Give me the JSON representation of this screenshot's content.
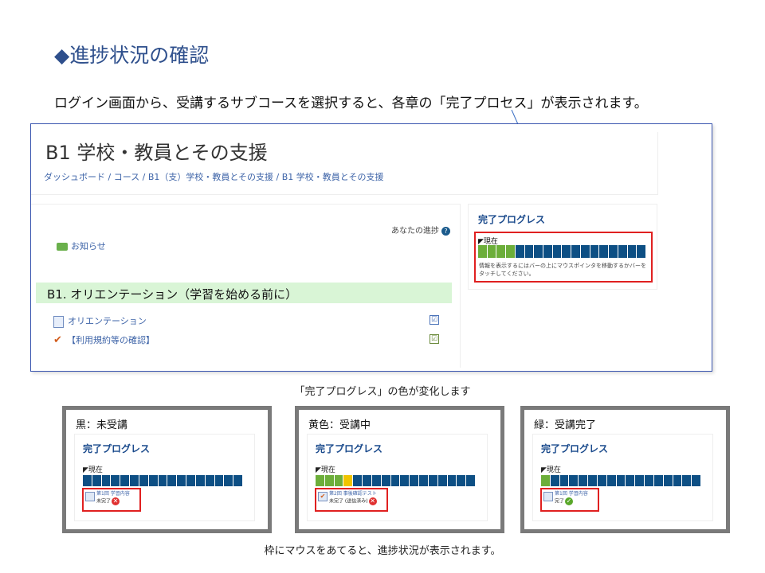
{
  "slide": {
    "title": "◆進捗状況の確認",
    "intro": "ログイン画面から、受講するサブコースを選択すると、各章の「完了プロセス」が表示されます。",
    "caption_middle": "「完了プログレス」の色が変化します",
    "caption_bottom": "枠にマウスをあてると、進捗状況が表示されます。"
  },
  "colors": {
    "dark": "#0d4f84",
    "green": "#6cae3a",
    "yellow": "#f0c400",
    "red": "#e02020"
  },
  "course": {
    "title": "B1 学校・教員とその支援",
    "breadcrumb": "ダッシュボード / コース / B1（支）学校・教員とその支援 / B1 学校・教員とその支援",
    "progress_label": "あなたの進捗",
    "help": "?",
    "news": "お知らせ",
    "section_title": "B1. オリエンテーション（学習を始める前に）",
    "activities": [
      "オリエンテーション",
      "【利用規約等の確認】"
    ],
    "check_mark": "☑"
  },
  "block": {
    "title": "完了プログレス",
    "now": "◤現在",
    "hint": "情報を表示するにはバーの上にマウスポインタを移動するかバーをタッチしてください。",
    "segments": [
      "green",
      "green",
      "green",
      "green",
      "dark",
      "dark",
      "dark",
      "dark",
      "dark",
      "dark",
      "dark",
      "dark",
      "dark",
      "dark",
      "dark",
      "dark",
      "dark",
      "dark"
    ]
  },
  "panels": [
    {
      "label": "黒：未受講",
      "title": "完了プログレス",
      "now": "◤現在",
      "tip_line1": "第1回 学習内容",
      "tip_line2": "未完了",
      "status": "x",
      "segments": [
        "dark",
        "dark",
        "dark",
        "dark",
        "dark",
        "dark",
        "dark",
        "dark",
        "dark",
        "dark",
        "dark",
        "dark",
        "dark",
        "dark",
        "dark",
        "dark",
        "dark"
      ]
    },
    {
      "label": "黄色：受講中",
      "title": "完了プログレス",
      "now": "◤現在",
      "tip_line1": "第2回 事後確認テスト",
      "tip_line2": "未完了 (送信済み)",
      "status": "x",
      "segments": [
        "green",
        "green",
        "green",
        "yellow",
        "dark",
        "dark",
        "dark",
        "dark",
        "dark",
        "dark",
        "dark",
        "dark",
        "dark",
        "dark",
        "dark",
        "dark",
        "dark"
      ]
    },
    {
      "label": "緑：受講完了",
      "title": "完了プログレス",
      "now": "◤現在",
      "tip_line1": "第1回 学習内容",
      "tip_line2": "完了",
      "status": "ok",
      "segments": [
        "green",
        "dark",
        "dark",
        "dark",
        "dark",
        "dark",
        "dark",
        "dark",
        "dark",
        "dark",
        "dark",
        "dark",
        "dark",
        "dark",
        "dark",
        "dark",
        "dark"
      ]
    }
  ],
  "icons": {
    "x": "✕",
    "ok": "✓",
    "quiz": "✔"
  }
}
